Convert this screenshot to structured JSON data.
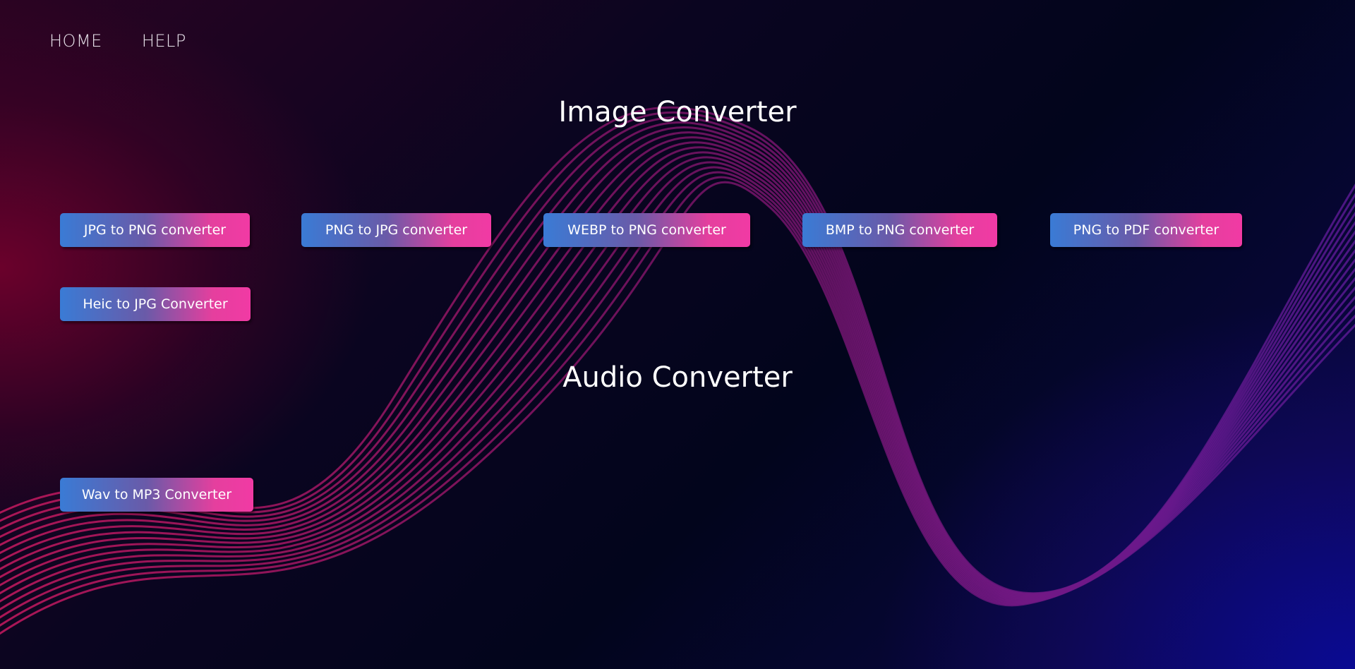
{
  "nav": {
    "items": [
      {
        "label": "HOME"
      },
      {
        "label": "HELP"
      }
    ]
  },
  "sections": {
    "image": {
      "title": "Image Converter",
      "buttons": [
        {
          "label": "JPG to PNG converter"
        },
        {
          "label": "PNG to JPG converter"
        },
        {
          "label": "WEBP to PNG converter"
        },
        {
          "label": "BMP to PNG converter"
        },
        {
          "label": "PNG to PDF converter"
        },
        {
          "label": "Heic to JPG Converter"
        }
      ]
    },
    "audio": {
      "title": "Audio Converter",
      "buttons": [
        {
          "label": "Wav to MP3 Converter"
        }
      ]
    }
  },
  "colors": {
    "button_gradient_start": "#3a7bd5",
    "button_gradient_end": "#f13aa4",
    "wave_left": "#c2185b",
    "wave_right": "#5a1a9a"
  }
}
